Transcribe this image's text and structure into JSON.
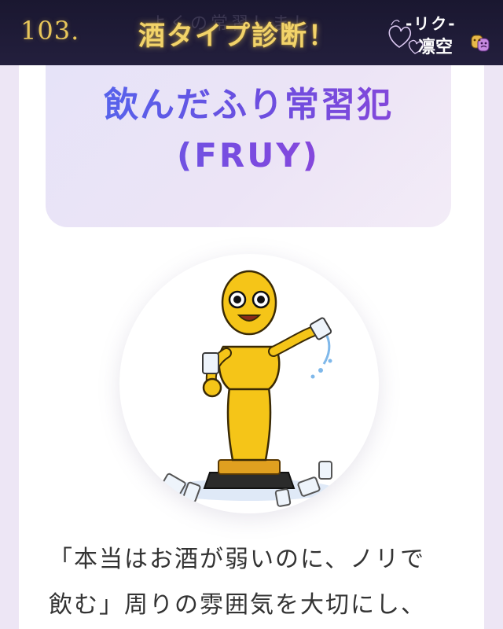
{
  "banner": {
    "episode_number": "103.",
    "title": "酒タイプ診断！",
    "faded_text": "よくの常習しまし",
    "brand_top": "-リク-",
    "brand_name": "凛空"
  },
  "result": {
    "type_name": "飲んだふり常習犯",
    "type_code": "(FRUY)"
  },
  "character": {
    "description": "yellow trophy-statue character holding a glass and pouring out another, standing among scattered glasses"
  },
  "description": {
    "lines": [
      "「本当はお酒が弱いのに、ノリで",
      "飲む」周りの雰囲気を大切にし、"
    ]
  },
  "icons": {
    "brand_mask": "theater-mask-icon",
    "hearts": "hearts-doodle-icon"
  },
  "colors": {
    "banner_bg": "#1a1730",
    "gold": "#f2d36a",
    "type_gradient_start": "#4f6af0",
    "type_gradient_end": "#8c45d8",
    "page_bg": "#ede6f5",
    "body_text": "#333333"
  }
}
